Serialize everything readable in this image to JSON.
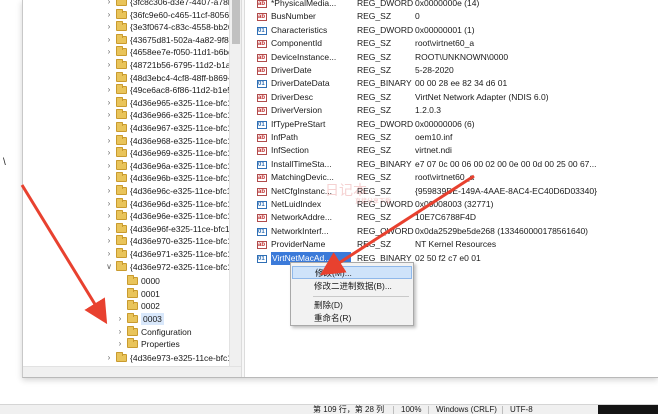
{
  "tree": {
    "items": [
      {
        "label": "{3fc8c306-d3e7-4407-a78b-e",
        "expanded": false
      },
      {
        "label": "{36fc9e60-c465-11cf-8056-44",
        "expanded": false
      },
      {
        "label": "{3e3f0674-c83c-4558-bb26-9",
        "expanded": false
      },
      {
        "label": "{43675d81-502a-4a82-9f84-b",
        "expanded": false
      },
      {
        "label": "{4658ee7e-f050-11d1-b6bd-0",
        "expanded": false
      },
      {
        "label": "{48721b56-6795-11d2-b1a8-0",
        "expanded": false
      },
      {
        "label": "{48d3ebc4-4cf8-48ff-b869-9c",
        "expanded": false
      },
      {
        "label": "{49ce6ac8-6f86-11d2-b1e5-0",
        "expanded": false
      },
      {
        "label": "{4d36e965-e325-11ce-bfc1-0",
        "expanded": false
      },
      {
        "label": "{4d36e966-e325-11ce-bfc1-0",
        "expanded": false
      },
      {
        "label": "{4d36e967-e325-11ce-bfc1-0",
        "expanded": false
      },
      {
        "label": "{4d36e968-e325-11ce-bfc1-0",
        "expanded": false
      },
      {
        "label": "{4d36e969-e325-11ce-bfc1-0",
        "expanded": false
      },
      {
        "label": "{4d36e96a-e325-11ce-bfc1-0",
        "expanded": false
      },
      {
        "label": "{4d36e96b-e325-11ce-bfc1-0",
        "expanded": false
      },
      {
        "label": "{4d36e96c-e325-11ce-bfc1-08",
        "expanded": false
      },
      {
        "label": "{4d36e96d-e325-11ce-bfc1-0",
        "expanded": false
      },
      {
        "label": "{4d36e96e-e325-11ce-bfc1-0",
        "expanded": false
      },
      {
        "label": "{4d36e96f-e325-11ce-bfc1-08",
        "expanded": false
      },
      {
        "label": "{4d36e970-e325-11ce-bfc1-0",
        "expanded": false
      },
      {
        "label": "{4d36e971-e325-11ce-bfc1-0",
        "expanded": false
      },
      {
        "label": "{4d36e972-e325-11ce-bfc1-0",
        "expanded": true
      }
    ],
    "children": [
      "0000",
      "0001",
      "0002",
      "0003",
      "Configuration",
      "Properties"
    ],
    "after": {
      "label": "{4d36e973-e325-11ce-bfc1-0"
    }
  },
  "values": [
    {
      "name": "*PhysicalMedia...",
      "type": "REG_DWORD",
      "data": "0x0000000e (14)",
      "icon": "sz"
    },
    {
      "name": "BusNumber",
      "type": "REG_SZ",
      "data": "0",
      "icon": "sz"
    },
    {
      "name": "Characteristics",
      "type": "REG_DWORD",
      "data": "0x00000001 (1)",
      "icon": "bin"
    },
    {
      "name": "ComponentId",
      "type": "REG_SZ",
      "data": "root\\virtnet60_a",
      "icon": "sz"
    },
    {
      "name": "DeviceInstance...",
      "type": "REG_SZ",
      "data": "ROOT\\UNKNOWN\\0000",
      "icon": "sz"
    },
    {
      "name": "DriverDate",
      "type": "REG_SZ",
      "data": "5-28-2020",
      "icon": "sz"
    },
    {
      "name": "DriverDateData",
      "type": "REG_BINARY",
      "data": "00 00 28 ee 82 34 d6 01",
      "icon": "bin"
    },
    {
      "name": "DriverDesc",
      "type": "REG_SZ",
      "data": "VirtNet Network Adapter (NDIS 6.0)",
      "icon": "sz"
    },
    {
      "name": "DriverVersion",
      "type": "REG_SZ",
      "data": "1.2.0.3",
      "icon": "sz"
    },
    {
      "name": "IfTypePreStart",
      "type": "REG_DWORD",
      "data": "0x00000006 (6)",
      "icon": "bin"
    },
    {
      "name": "InfPath",
      "type": "REG_SZ",
      "data": "oem10.inf",
      "icon": "sz"
    },
    {
      "name": "InfSection",
      "type": "REG_SZ",
      "data": "virtnet.ndi",
      "icon": "sz"
    },
    {
      "name": "InstallTimeSta...",
      "type": "REG_BINARY",
      "data": "e7 07 0c 00 06 00 02 00 0e 00 0d 00 25 00 67...",
      "icon": "bin"
    },
    {
      "name": "MatchingDevic...",
      "type": "REG_SZ",
      "data": "root\\virtnet60_a",
      "icon": "sz"
    },
    {
      "name": "NetCfgInstanc...",
      "type": "REG_SZ",
      "data": "{959839DE-149A-4AAE-8AC4-EC40D6D03340}",
      "icon": "sz"
    },
    {
      "name": "NetLuidIndex",
      "type": "REG_DWORD",
      "data": "0x00008003 (32771)",
      "icon": "bin"
    },
    {
      "name": "NetworkAddre...",
      "type": "REG_SZ",
      "data": "10E7C6788F4D",
      "icon": "sz"
    },
    {
      "name": "NetworkInterf...",
      "type": "REG_QWORD",
      "data": "0x0da2529be5de268 (133460000178561640)",
      "icon": "bin"
    },
    {
      "name": "ProviderName",
      "type": "REG_SZ",
      "data": "NT Kernel Resources",
      "icon": "sz"
    },
    {
      "name": "VirtNetMacAd...",
      "type": "REG_BINARY",
      "data": "02 50 f2 c7 e0 01",
      "icon": "bin",
      "selected": true
    }
  ],
  "context_menu": {
    "modify": "修改(M)...",
    "modify_binary": "修改二进制数据(B)...",
    "delete": "删除(D)",
    "rename": "重命名(R)"
  },
  "watermark": {
    "main": "日记本",
    "sub": "直接分享下载"
  },
  "statusbar": {
    "position": "第 109 行，第 28 列",
    "zoom": "100%",
    "line_ending": "Windows (CRLF)",
    "encoding": "UTF-8"
  },
  "misc": {
    "backslash": "\\"
  },
  "colors": {
    "selection": "#3b7ad9",
    "arrow": "#e8412f",
    "folder": "#e9c45a"
  }
}
